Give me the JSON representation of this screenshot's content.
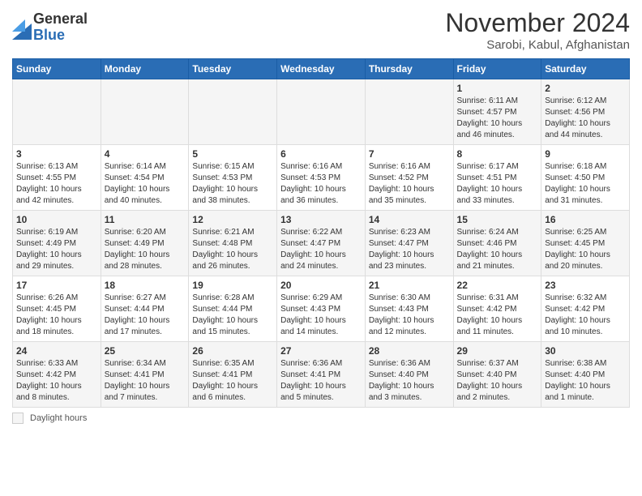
{
  "logo": {
    "general": "General",
    "blue": "Blue"
  },
  "title": "November 2024",
  "location": "Sarobi, Kabul, Afghanistan",
  "weekdays": [
    "Sunday",
    "Monday",
    "Tuesday",
    "Wednesday",
    "Thursday",
    "Friday",
    "Saturday"
  ],
  "footer": {
    "label": "Daylight hours"
  },
  "weeks": [
    {
      "days": [
        null,
        null,
        null,
        null,
        null,
        {
          "date": "1",
          "sunrise": "Sunrise: 6:11 AM",
          "sunset": "Sunset: 4:57 PM",
          "daylight": "Daylight: 10 hours and 46 minutes."
        },
        {
          "date": "2",
          "sunrise": "Sunrise: 6:12 AM",
          "sunset": "Sunset: 4:56 PM",
          "daylight": "Daylight: 10 hours and 44 minutes."
        }
      ]
    },
    {
      "days": [
        {
          "date": "3",
          "sunrise": "Sunrise: 6:13 AM",
          "sunset": "Sunset: 4:55 PM",
          "daylight": "Daylight: 10 hours and 42 minutes."
        },
        {
          "date": "4",
          "sunrise": "Sunrise: 6:14 AM",
          "sunset": "Sunset: 4:54 PM",
          "daylight": "Daylight: 10 hours and 40 minutes."
        },
        {
          "date": "5",
          "sunrise": "Sunrise: 6:15 AM",
          "sunset": "Sunset: 4:53 PM",
          "daylight": "Daylight: 10 hours and 38 minutes."
        },
        {
          "date": "6",
          "sunrise": "Sunrise: 6:16 AM",
          "sunset": "Sunset: 4:53 PM",
          "daylight": "Daylight: 10 hours and 36 minutes."
        },
        {
          "date": "7",
          "sunrise": "Sunrise: 6:16 AM",
          "sunset": "Sunset: 4:52 PM",
          "daylight": "Daylight: 10 hours and 35 minutes."
        },
        {
          "date": "8",
          "sunrise": "Sunrise: 6:17 AM",
          "sunset": "Sunset: 4:51 PM",
          "daylight": "Daylight: 10 hours and 33 minutes."
        },
        {
          "date": "9",
          "sunrise": "Sunrise: 6:18 AM",
          "sunset": "Sunset: 4:50 PM",
          "daylight": "Daylight: 10 hours and 31 minutes."
        }
      ]
    },
    {
      "days": [
        {
          "date": "10",
          "sunrise": "Sunrise: 6:19 AM",
          "sunset": "Sunset: 4:49 PM",
          "daylight": "Daylight: 10 hours and 29 minutes."
        },
        {
          "date": "11",
          "sunrise": "Sunrise: 6:20 AM",
          "sunset": "Sunset: 4:49 PM",
          "daylight": "Daylight: 10 hours and 28 minutes."
        },
        {
          "date": "12",
          "sunrise": "Sunrise: 6:21 AM",
          "sunset": "Sunset: 4:48 PM",
          "daylight": "Daylight: 10 hours and 26 minutes."
        },
        {
          "date": "13",
          "sunrise": "Sunrise: 6:22 AM",
          "sunset": "Sunset: 4:47 PM",
          "daylight": "Daylight: 10 hours and 24 minutes."
        },
        {
          "date": "14",
          "sunrise": "Sunrise: 6:23 AM",
          "sunset": "Sunset: 4:47 PM",
          "daylight": "Daylight: 10 hours and 23 minutes."
        },
        {
          "date": "15",
          "sunrise": "Sunrise: 6:24 AM",
          "sunset": "Sunset: 4:46 PM",
          "daylight": "Daylight: 10 hours and 21 minutes."
        },
        {
          "date": "16",
          "sunrise": "Sunrise: 6:25 AM",
          "sunset": "Sunset: 4:45 PM",
          "daylight": "Daylight: 10 hours and 20 minutes."
        }
      ]
    },
    {
      "days": [
        {
          "date": "17",
          "sunrise": "Sunrise: 6:26 AM",
          "sunset": "Sunset: 4:45 PM",
          "daylight": "Daylight: 10 hours and 18 minutes."
        },
        {
          "date": "18",
          "sunrise": "Sunrise: 6:27 AM",
          "sunset": "Sunset: 4:44 PM",
          "daylight": "Daylight: 10 hours and 17 minutes."
        },
        {
          "date": "19",
          "sunrise": "Sunrise: 6:28 AM",
          "sunset": "Sunset: 4:44 PM",
          "daylight": "Daylight: 10 hours and 15 minutes."
        },
        {
          "date": "20",
          "sunrise": "Sunrise: 6:29 AM",
          "sunset": "Sunset: 4:43 PM",
          "daylight": "Daylight: 10 hours and 14 minutes."
        },
        {
          "date": "21",
          "sunrise": "Sunrise: 6:30 AM",
          "sunset": "Sunset: 4:43 PM",
          "daylight": "Daylight: 10 hours and 12 minutes."
        },
        {
          "date": "22",
          "sunrise": "Sunrise: 6:31 AM",
          "sunset": "Sunset: 4:42 PM",
          "daylight": "Daylight: 10 hours and 11 minutes."
        },
        {
          "date": "23",
          "sunrise": "Sunrise: 6:32 AM",
          "sunset": "Sunset: 4:42 PM",
          "daylight": "Daylight: 10 hours and 10 minutes."
        }
      ]
    },
    {
      "days": [
        {
          "date": "24",
          "sunrise": "Sunrise: 6:33 AM",
          "sunset": "Sunset: 4:42 PM",
          "daylight": "Daylight: 10 hours and 8 minutes."
        },
        {
          "date": "25",
          "sunrise": "Sunrise: 6:34 AM",
          "sunset": "Sunset: 4:41 PM",
          "daylight": "Daylight: 10 hours and 7 minutes."
        },
        {
          "date": "26",
          "sunrise": "Sunrise: 6:35 AM",
          "sunset": "Sunset: 4:41 PM",
          "daylight": "Daylight: 10 hours and 6 minutes."
        },
        {
          "date": "27",
          "sunrise": "Sunrise: 6:36 AM",
          "sunset": "Sunset: 4:41 PM",
          "daylight": "Daylight: 10 hours and 5 minutes."
        },
        {
          "date": "28",
          "sunrise": "Sunrise: 6:36 AM",
          "sunset": "Sunset: 4:40 PM",
          "daylight": "Daylight: 10 hours and 3 minutes."
        },
        {
          "date": "29",
          "sunrise": "Sunrise: 6:37 AM",
          "sunset": "Sunset: 4:40 PM",
          "daylight": "Daylight: 10 hours and 2 minutes."
        },
        {
          "date": "30",
          "sunrise": "Sunrise: 6:38 AM",
          "sunset": "Sunset: 4:40 PM",
          "daylight": "Daylight: 10 hours and 1 minute."
        }
      ]
    }
  ]
}
